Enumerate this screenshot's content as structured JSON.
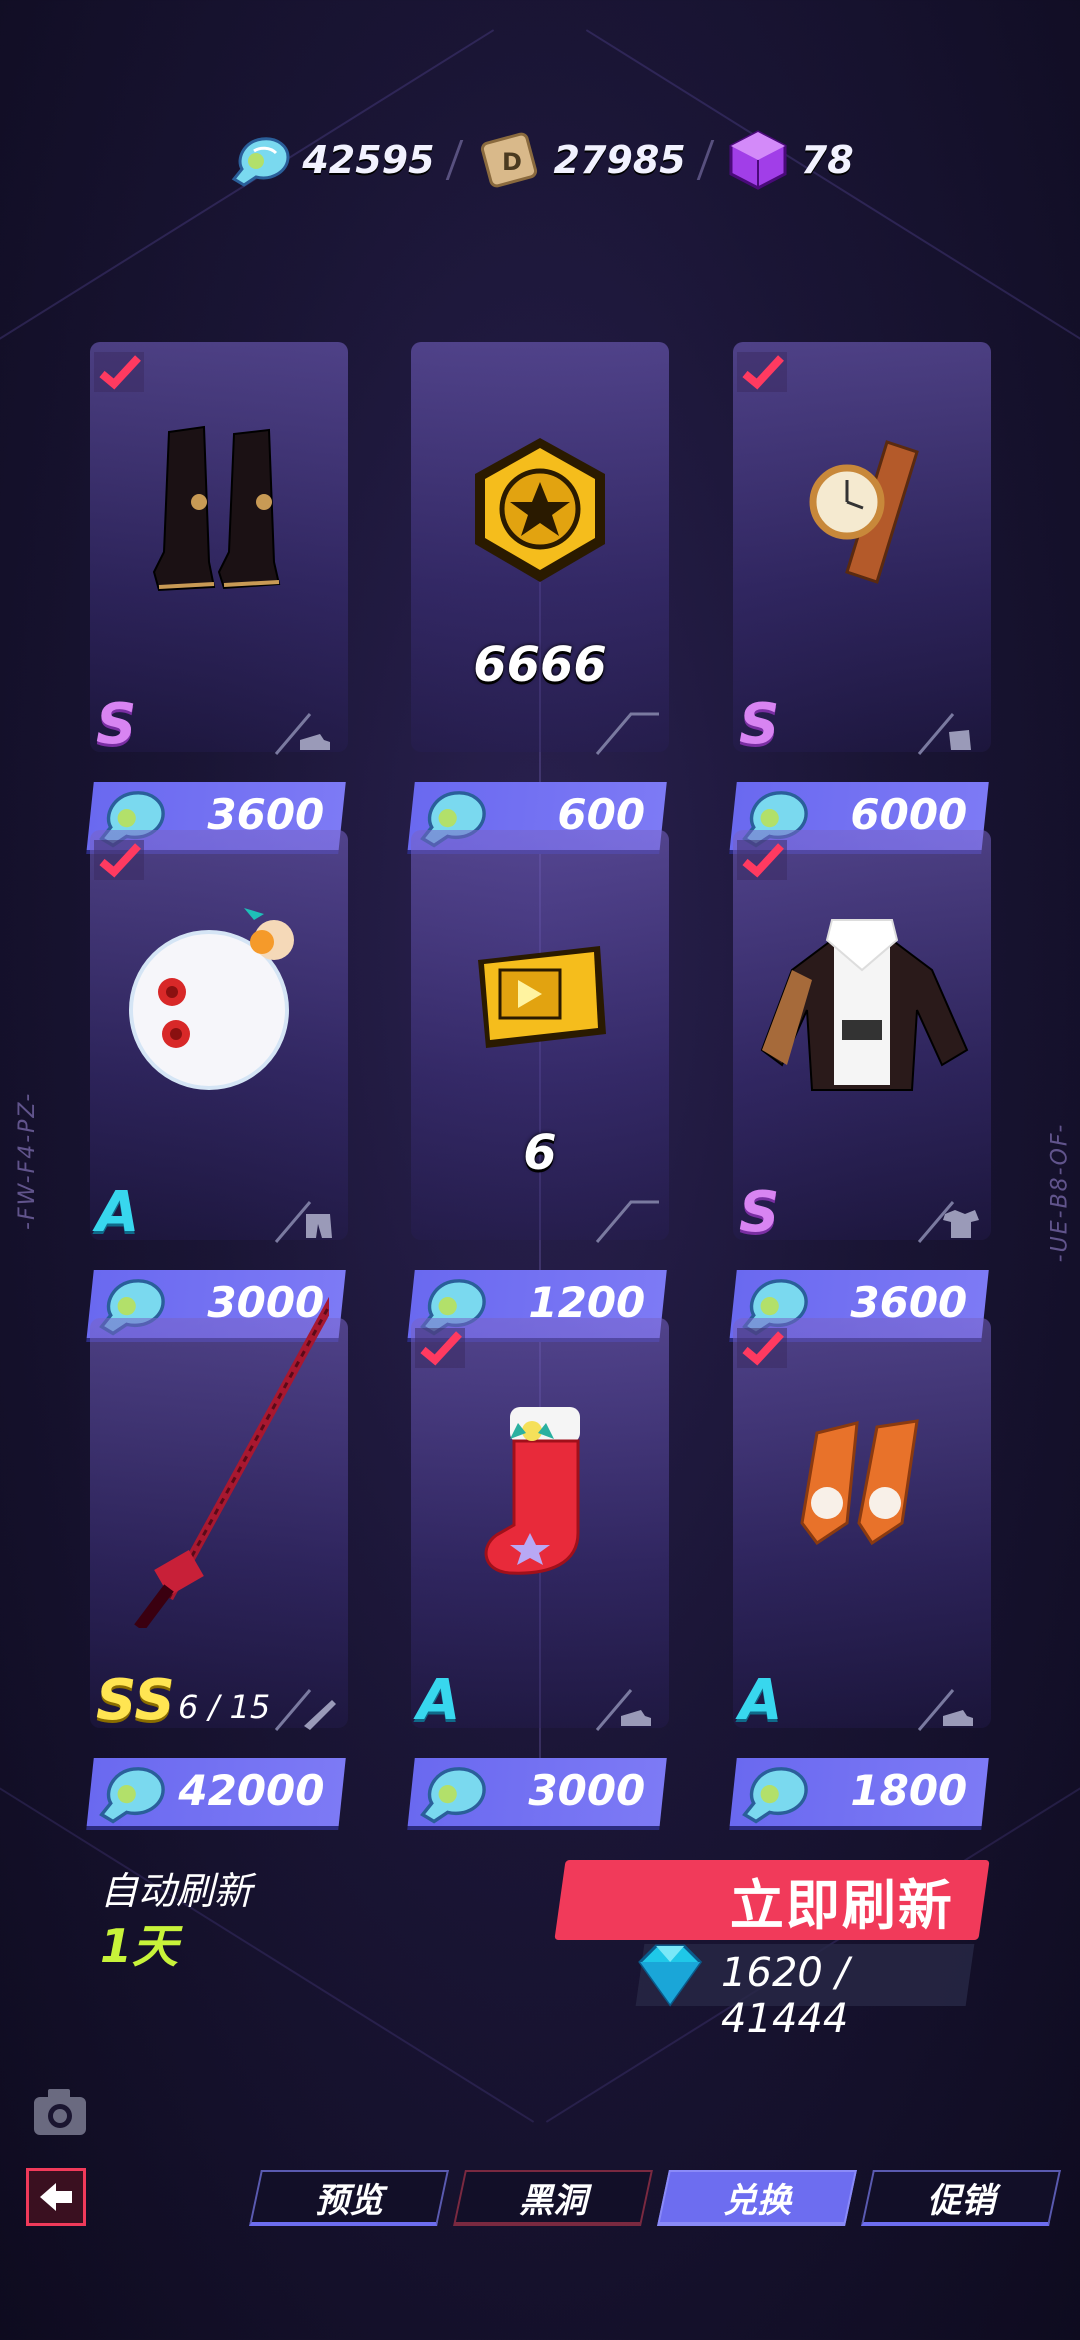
{
  "currencies": [
    {
      "icon": "fish-currency-icon",
      "value": "42595"
    },
    {
      "icon": "d-coin-icon",
      "value": "27985"
    },
    {
      "icon": "purple-cube-icon",
      "value": "78"
    }
  ],
  "items": [
    {
      "name": "black-boots",
      "rank": "S",
      "price": "3600",
      "owned": true,
      "slot": "shoes"
    },
    {
      "name": "gold-token",
      "quantity": "6666",
      "price": "600",
      "owned": false
    },
    {
      "name": "wrist-watch",
      "rank": "S",
      "price": "6000",
      "owned": true,
      "slot": "glove"
    },
    {
      "name": "snowball-accessory",
      "rank": "A",
      "price": "3000",
      "owned": true,
      "slot": "pants"
    },
    {
      "name": "video-ticket",
      "quantity": "6",
      "price": "1200",
      "owned": false
    },
    {
      "name": "bomber-jacket",
      "rank": "S",
      "price": "3600",
      "owned": true,
      "slot": "top"
    },
    {
      "name": "red-katana",
      "rank": "SS",
      "progress": "6 / 15",
      "price": "42000",
      "owned": false,
      "slot": "weapon"
    },
    {
      "name": "christmas-stocking-boots",
      "rank": "A",
      "price": "3000",
      "owned": true,
      "slot": "shoes"
    },
    {
      "name": "orange-pom-shoes",
      "rank": "A",
      "price": "1800",
      "owned": true,
      "slot": "shoes"
    }
  ],
  "side_tags": {
    "left": "-FW-F4-PZ-",
    "right": "-UE-B8-OF-"
  },
  "refresh": {
    "auto_label": "自动刷新",
    "auto_value": "1天",
    "button_label": "立即刷新",
    "cost": "1620 / 41444"
  },
  "tabs": [
    {
      "label": "预览",
      "active": false
    },
    {
      "label": "黑洞",
      "active": false
    },
    {
      "label": "兑换",
      "active": true
    },
    {
      "label": "促销",
      "active": false
    }
  ],
  "colors": {
    "accent": "#6d6df0",
    "refresh": "#f13a5a",
    "rank_S": "#d884f2",
    "rank_A": "#38d7ee",
    "rank_SS": "#ffe552"
  }
}
